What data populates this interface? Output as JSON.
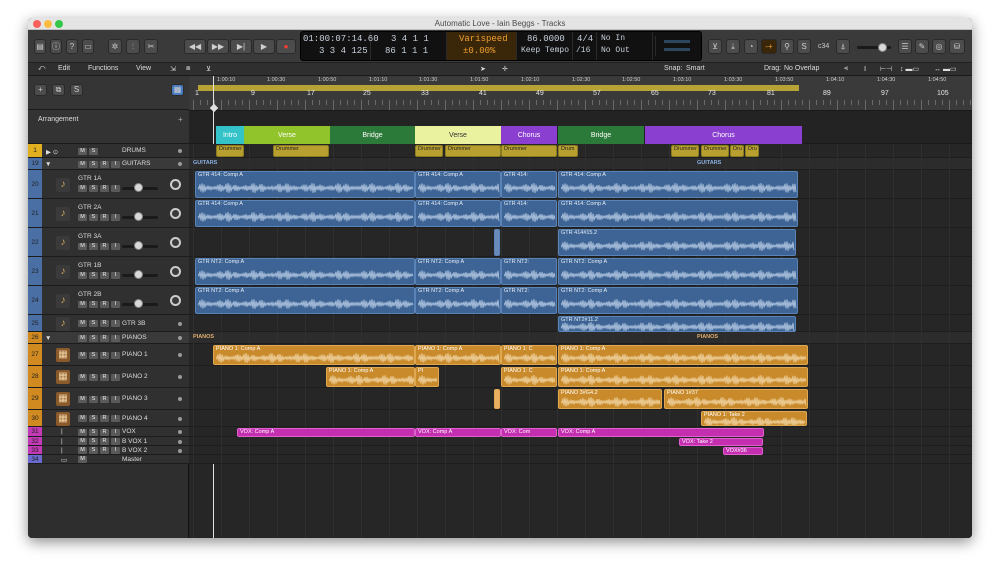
{
  "window": {
    "title": "Automatic Love - Iain Beggs - Tracks"
  },
  "transport": {
    "position_time": "01:00:07:14.60",
    "position_bars": "3 3 4 125",
    "end_bars_top": "3 4 1 1",
    "end_bars_bottom": "86 1 1 1",
    "varispeed_label": "Varispeed",
    "varispeed_value": "±0.00%",
    "tempo": "86.0000",
    "tempo_mode": "Keep Tempo",
    "time_sig": "4/4",
    "division": "/16",
    "in_label": "No In",
    "out_label": "No Out"
  },
  "toolbar": {
    "cpu_label": "c34"
  },
  "menubar": {
    "edit": "Edit",
    "functions": "Functions",
    "view": "View",
    "snap_label": "Snap:",
    "snap_value": "Smart",
    "drag_label": "Drag:",
    "drag_value": "No Overlap"
  },
  "sidebar": {
    "arrangement_label": "Arrangement"
  },
  "ruler": {
    "times": [
      "1:00:10",
      "1:00:30",
      "1:00:50",
      "1:01:10",
      "1:01:30",
      "1:01:50",
      "1:02:10",
      "1:02:30",
      "1:02:50",
      "1:03:10",
      "1:03:30",
      "1:03:50",
      "1:04:10",
      "1:04:30",
      "1:04:50"
    ],
    "bars": [
      "1",
      "9",
      "17",
      "25",
      "33",
      "41",
      "49",
      "57",
      "65",
      "73",
      "81",
      "89",
      "97",
      "105"
    ]
  },
  "markers": [
    {
      "label": "Intro",
      "color": "#34c3c8"
    },
    {
      "label": "Verse",
      "color": "#90c42a"
    },
    {
      "label": "Bridge",
      "color": "#2c7a3a"
    },
    {
      "label": "Verse",
      "color": "#eaf2a0"
    },
    {
      "label": "Chorus",
      "color": "#8a3fd0"
    },
    {
      "label": "Bridge",
      "color": "#2c7a3a"
    },
    {
      "label": "Chorus",
      "color": "#8a3fd0"
    }
  ],
  "tracks": [
    {
      "num": "1",
      "name": "DRUMS",
      "buttons": [
        "M",
        "S"
      ]
    },
    {
      "num": "19",
      "name": "GUITARS",
      "buttons": [
        "M",
        "S",
        "R",
        "I"
      ]
    },
    {
      "num": "20",
      "name": "GTR 1A",
      "buttons": [
        "M",
        "S",
        "R",
        "I"
      ]
    },
    {
      "num": "21",
      "name": "GTR 2A",
      "buttons": [
        "M",
        "S",
        "R",
        "I"
      ]
    },
    {
      "num": "22",
      "name": "GTR 3A",
      "buttons": [
        "M",
        "S",
        "R",
        "I"
      ]
    },
    {
      "num": "23",
      "name": "GTR 1B",
      "buttons": [
        "M",
        "S",
        "R",
        "I"
      ]
    },
    {
      "num": "24",
      "name": "GTR 2B",
      "buttons": [
        "M",
        "S",
        "R",
        "I"
      ]
    },
    {
      "num": "25",
      "name": "GTR 3B",
      "buttons": [
        "M",
        "S",
        "R",
        "I"
      ]
    },
    {
      "num": "26",
      "name": "PIANOS",
      "buttons": [
        "M",
        "S",
        "R",
        "I"
      ]
    },
    {
      "num": "27",
      "name": "PIANO 1",
      "buttons": [
        "M",
        "S",
        "R",
        "I"
      ]
    },
    {
      "num": "28",
      "name": "PIANO 2",
      "buttons": [
        "M",
        "S",
        "R",
        "I"
      ]
    },
    {
      "num": "29",
      "name": "PIANO 3",
      "buttons": [
        "M",
        "S",
        "R",
        "I"
      ]
    },
    {
      "num": "30",
      "name": "PIANO 4",
      "buttons": [
        "M",
        "S",
        "R",
        "I"
      ]
    },
    {
      "num": "31",
      "name": "VOX",
      "buttons": [
        "M",
        "S",
        "R",
        "I"
      ]
    },
    {
      "num": "32",
      "name": "B VOX 1",
      "buttons": [
        "M",
        "S",
        "R",
        "I"
      ]
    },
    {
      "num": "33",
      "name": "B VOX 2",
      "buttons": [
        "M",
        "S",
        "R",
        "I"
      ]
    },
    {
      "num": "34",
      "name": "Master",
      "buttons": [
        "M"
      ]
    }
  ],
  "lanes": {
    "drums": [
      "Drummer",
      "Drummer",
      "Drummer",
      "Drummer",
      "Drummer",
      "Drum",
      "Drummer",
      "Drummer",
      "Dru",
      "Dru"
    ],
    "guitars_folder": "GUITARS",
    "gtr1a": [
      "GTR 414: Comp A",
      "GTR 414: Comp A",
      "GTR 414:",
      "GTR 414: Comp A"
    ],
    "gtr2a": [
      "GTR 414: Comp A",
      "GTR 414: Comp A",
      "GTR 414:",
      "GTR 414: Comp A"
    ],
    "gtr3a": [
      "GTR 414#15.2"
    ],
    "gtr1b": [
      "GTR NT2: Comp A",
      "GTR NT2: Comp A",
      "GTR NT2:",
      "GTR NT2: Comp A"
    ],
    "gtr2b": [
      "GTR NT2: Comp A",
      "GTR NT2: Comp A",
      "GTR NT2:",
      "GTR NT2: Comp A"
    ],
    "gtr3b": [
      "GTR NT2#11.2"
    ],
    "pianos_folder": "PIANOS",
    "piano1": [
      "PIANO 1: Comp A",
      "PIANO 1: Comp A",
      "PIANO 1: C",
      "PIANO 1: Comp A"
    ],
    "piano2": [
      "PIANO 1: Comp A",
      "PI",
      "PIANO 1: C",
      "PIANO 1: Comp A"
    ],
    "piano3": [
      "PIANO 3#G4.2",
      "PIANO 1#37"
    ],
    "piano4": [
      "PIANO 1: Take 2"
    ],
    "vox": [
      "VOX: Comp A",
      "VOX: Comp A",
      "VOX: Com",
      "VOX: Comp A"
    ],
    "bvox1": [
      "VOX: Take 2"
    ],
    "bvox2": [
      "VOX#36"
    ]
  }
}
